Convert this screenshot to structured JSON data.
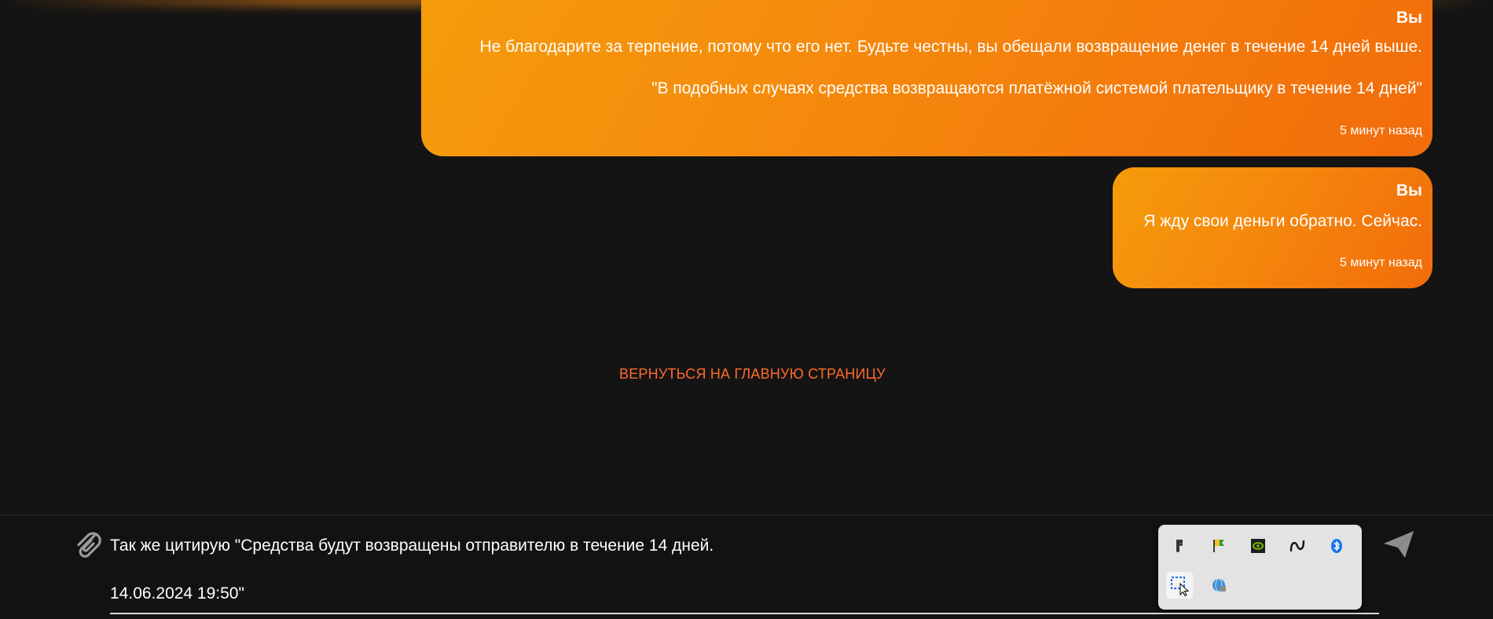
{
  "messages": [
    {
      "sender": "Вы",
      "lines": [
        "Не благодарите за терпение, потому что его нет. Будьте честны, вы обещали возвращение денег в течение 14 дней выше.",
        "\"В подобных случаях средства возвращаются платёжной системой плательщику в течение 14 дней\""
      ],
      "time": "5 минут назад"
    },
    {
      "sender": "Вы",
      "lines": [
        "Я жду свои деньги обратно. Сейчас."
      ],
      "time": "5 минут назад"
    }
  ],
  "back_link": "ВЕРНУТЬСЯ НА ГЛАВНУЮ СТРАНИЦУ",
  "composer": {
    "lines": [
      "Так же цитирую \"Средства будут возвращены отправителю в течение 14 дней.",
      "14.06.2024 19:50\""
    ]
  },
  "tray": {
    "icons": [
      "figma-icon",
      "flag-icon",
      "nvidia-icon",
      "wave-app-icon",
      "bluetooth-icon",
      "snipping-tool-icon",
      "network-globe-icon"
    ]
  },
  "colors": {
    "background": "#141414",
    "bubble_start": "#f59c0b",
    "bubble_end": "#f26c0b",
    "link": "#ff6a2b"
  }
}
